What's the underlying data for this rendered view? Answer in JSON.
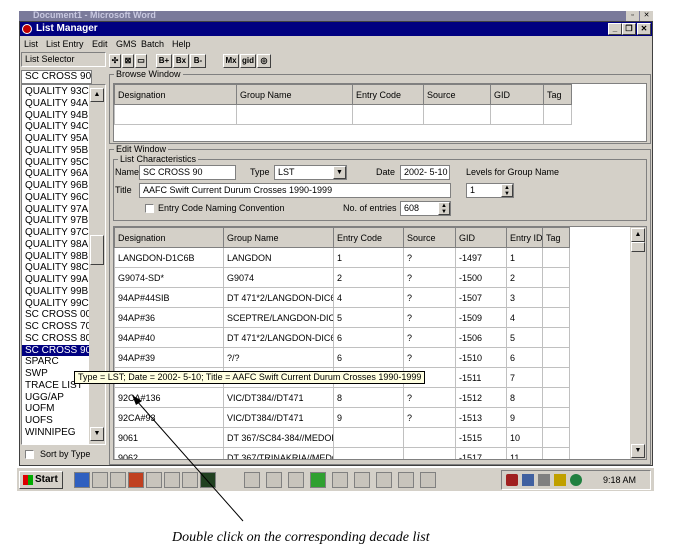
{
  "outer_window": {
    "title": "Document1 - Microsoft Word"
  },
  "window": {
    "title": "List Manager"
  },
  "menubar": [
    "List",
    "List Entry",
    "Edit",
    "GMS",
    "Batch",
    "Help"
  ],
  "list_selector": {
    "label": "List Selector",
    "current": "SC CROSS 90",
    "items": [
      "QUALITY 93C",
      "QUALITY 94A",
      "QUALITY 94B",
      "QUALITY 94C",
      "QUALITY 95A",
      "QUALITY 95B",
      "QUALITY 95C",
      "QUALITY 96A",
      "QUALITY 96B",
      "QUALITY 96C",
      "QUALITY 97A",
      "QUALITY 97B",
      "QUALITY 97C",
      "QUALITY 98A",
      "QUALITY 98B",
      "QUALITY 98C",
      "QUALITY 99A",
      "QUALITY 99B",
      "QUALITY 99C",
      "SC CROSS 00",
      "SC CROSS 70",
      "SC CROSS 80",
      "SC CROSS 90",
      "SPARC",
      "SWP",
      "TRACE LIST",
      "UGG/AP",
      "UOFM",
      "UOFS",
      "WINNIPEG"
    ],
    "selected_index": 22,
    "sort_label": "Sort by Type"
  },
  "toolbar": {
    "b_plus": "B+",
    "bx": "Bx",
    "b_minus": "B-",
    "mx": "Mx",
    "gid": "gid"
  },
  "browse_window": {
    "label": "Browse Window",
    "columns": [
      "Designation",
      "Group Name",
      "Entry Code",
      "Source",
      "GID",
      "Tag"
    ]
  },
  "edit_window": {
    "label": "Edit Window",
    "list_characteristics_label": "List Characteristics",
    "name_label": "Name",
    "name_value": "SC CROSS 90",
    "type_label": "Type",
    "type_value": "LST",
    "date_label": "Date",
    "date_value": "2002- 5-10",
    "levels_label": "Levels for Group Name",
    "levels_value": "1",
    "title_label": "Title",
    "title_value": "AAFC Swift Current Durum Crosses 1990-1999",
    "entry_code_label": "Entry Code Naming Convention",
    "num_entries_label": "No. of entries",
    "num_entries_value": "608"
  },
  "grid": {
    "columns": [
      "Designation",
      "Group Name",
      "Entry Code",
      "Source",
      "GID",
      "Entry ID",
      "Tag"
    ],
    "rows": [
      [
        "LANGDON-D1C6B",
        "LANGDON",
        "1",
        "?",
        "-1497",
        "1",
        ""
      ],
      [
        "G9074-SD*",
        "G9074",
        "2",
        "?",
        "-1500",
        "2",
        ""
      ],
      [
        "94AP#44SIB",
        "DT 471*2/LANGDON-DIC6B",
        "4",
        "?",
        "-1507",
        "3",
        ""
      ],
      [
        "94AP#36",
        "SCEPTRE/LANGDON-DIC6B",
        "5",
        "?",
        "-1509",
        "4",
        ""
      ],
      [
        "94AP#40",
        "DT 471*2/LANGDON-DIC6B",
        "6",
        "?",
        "-1506",
        "5",
        ""
      ],
      [
        "94AP#39",
        "?/?",
        "6",
        "?",
        "-1510",
        "6",
        ""
      ],
      [
        "",
        "",
        "",
        "",
        "-1511",
        "7",
        ""
      ],
      [
        "92CA#136",
        "VIC/DT384//DT471",
        "8",
        "?",
        "-1512",
        "8",
        ""
      ],
      [
        "92CA#93",
        "VIC/DT384//DT471",
        "9",
        "?",
        "-1513",
        "9",
        ""
      ],
      [
        "9061",
        "DT 367/SC84-384//MEDORA",
        "",
        "",
        "-1515",
        "10",
        ""
      ],
      [
        "9062",
        "DT 367/TRINAKRIA//MEDORA",
        "",
        "",
        "-1517",
        "11",
        ""
      ]
    ]
  },
  "tooltip": "Type = LST; Date = 2002- 5-10; Title = AAFC Swift Current Durum Crosses 1990-1999",
  "taskbar": {
    "start": "Start",
    "clock": "9:18 AM"
  },
  "caption": "Double click on the corresponding decade list"
}
